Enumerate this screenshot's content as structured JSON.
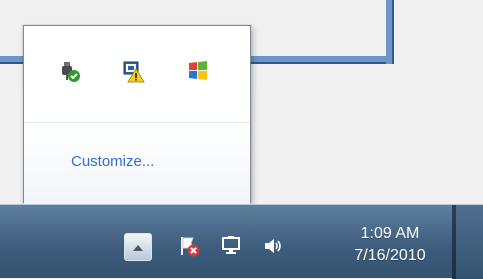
{
  "flyout": {
    "customize_label": "Customize...",
    "icons": [
      {
        "name": "usb-safely-remove-icon"
      },
      {
        "name": "network-warning-icon"
      },
      {
        "name": "windows-flag-icon"
      }
    ]
  },
  "taskbar": {
    "show_hidden_icons": "up-arrow-icon",
    "icons": [
      {
        "name": "action-center-flag-error-icon"
      },
      {
        "name": "network-computer-icon"
      },
      {
        "name": "volume-speaker-icon"
      }
    ],
    "clock": {
      "time": "1:09 AM",
      "date": "7/16/2010"
    }
  },
  "colors": {
    "link": "#2f6fd1",
    "taskbar_top": "#5f7fa0",
    "taskbar_bottom": "#35526f"
  }
}
